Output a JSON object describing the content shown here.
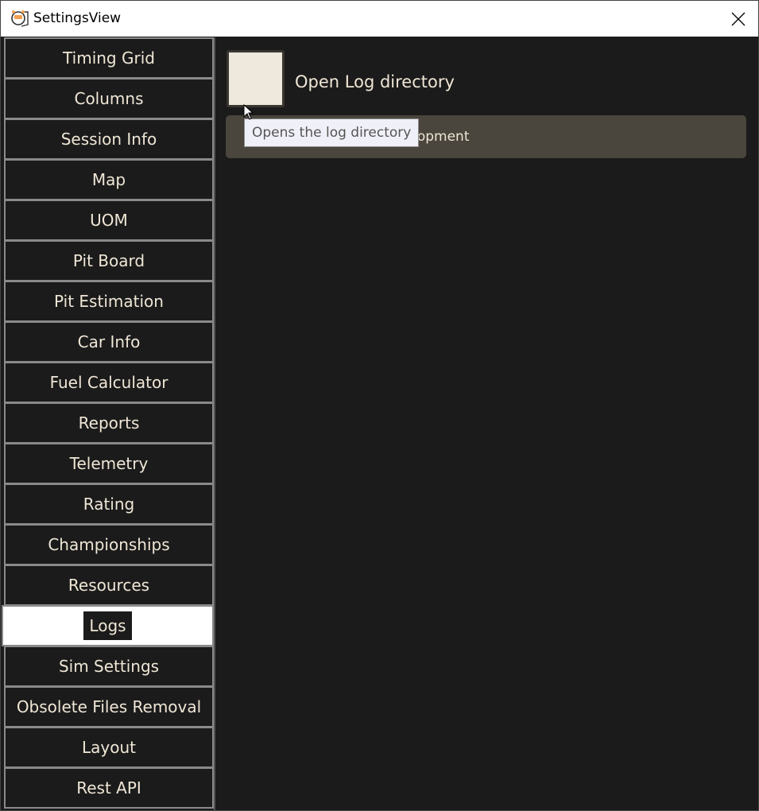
{
  "window": {
    "title": "SettingsView",
    "icon": "stopwatch-app-icon",
    "close_icon": "close-icon"
  },
  "sidebar": {
    "items": [
      {
        "label": "Timing Grid",
        "selected": false
      },
      {
        "label": "Columns",
        "selected": false
      },
      {
        "label": "Session Info",
        "selected": false
      },
      {
        "label": "Map",
        "selected": false
      },
      {
        "label": "UOM",
        "selected": false
      },
      {
        "label": "Pit Board",
        "selected": false
      },
      {
        "label": "Pit Estimation",
        "selected": false
      },
      {
        "label": "Car Info",
        "selected": false
      },
      {
        "label": "Fuel Calculator",
        "selected": false
      },
      {
        "label": "Reports",
        "selected": false
      },
      {
        "label": "Telemetry",
        "selected": false
      },
      {
        "label": "Rating",
        "selected": false
      },
      {
        "label": "Championships",
        "selected": false
      },
      {
        "label": "Resources",
        "selected": false
      },
      {
        "label": "Logs",
        "selected": true
      },
      {
        "label": "Sim Settings",
        "selected": false
      },
      {
        "label": "Obsolete Files Removal",
        "selected": false
      },
      {
        "label": "Layout",
        "selected": false
      },
      {
        "label": "Rest API",
        "selected": false
      }
    ]
  },
  "content": {
    "open_log_label": "Open Log directory",
    "donate_label": "Donate to support development",
    "tooltip": "Opens the log directory"
  },
  "colors": {
    "background": "#1b1b1b",
    "text": "#efe6d6",
    "button_fill": "#efe8dd",
    "donate_bar": "#4a453d",
    "selected_bg": "#ffffff"
  }
}
